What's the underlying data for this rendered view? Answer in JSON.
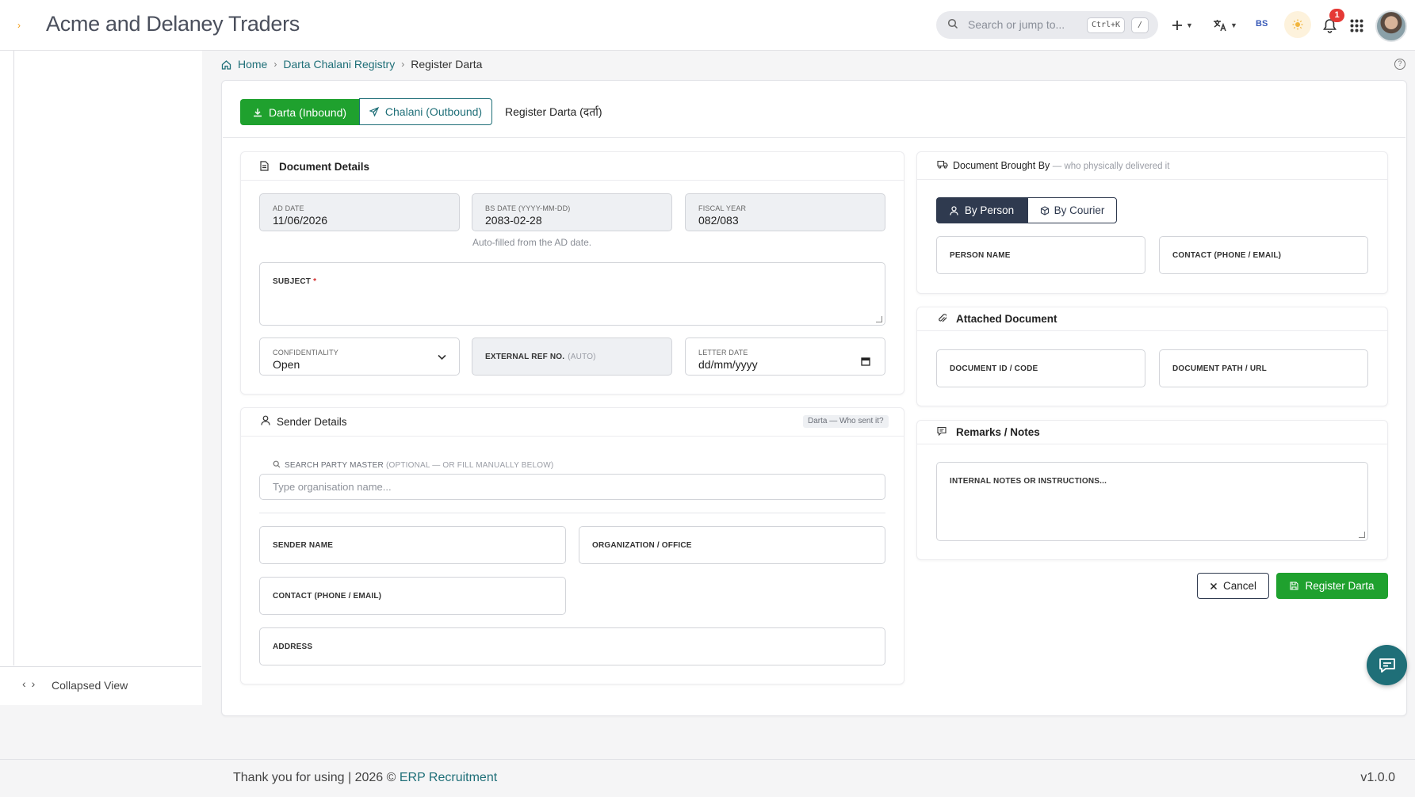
{
  "app": {
    "brand": "Acme and Delaney Traders"
  },
  "topbar": {
    "search_placeholder": "Search or jump to...",
    "shortcut": "Ctrl+K",
    "slash": "/",
    "calendar_label": "BS",
    "notification_count": "1"
  },
  "sidebar": {
    "collapse_label": "Collapsed View"
  },
  "breadcrumb": {
    "home": "Home",
    "registry": "Darta Chalani Registry",
    "current": "Register Darta"
  },
  "tabs": {
    "inbound": "Darta (Inbound)",
    "outbound": "Chalani (Outbound)",
    "title": "Register Darta (दर्ता)"
  },
  "document_details": {
    "title": "Document Details",
    "ad_date_label": "AD DATE",
    "ad_date": "11/06/2026",
    "bs_date_label": "BS DATE (YYYY-MM-DD)",
    "bs_date": "2083-02-28",
    "bs_hint": "Auto-filled from the AD date.",
    "fiscal_year_label": "FISCAL YEAR",
    "fiscal_year": "082/083",
    "subject_label": "SUBJECT",
    "confidentiality_label": "CONFIDENTIALITY",
    "confidentiality": "Open",
    "ext_ref_label": "EXTERNAL REF NO.",
    "ext_ref_muted": "(AUTO)",
    "letter_date_label": "LETTER DATE",
    "letter_date": "dd/mm/yyyy"
  },
  "sender_details": {
    "title": "Sender Details",
    "chip": "Darta — Who sent it?",
    "search_label": "SEARCH PARTY MASTER",
    "search_label_muted": "(OPTIONAL — OR FILL MANUALLY BELOW)",
    "search_placeholder": "Type organisation name...",
    "sender_name": "SENDER NAME",
    "organization": "ORGANIZATION / OFFICE",
    "contact": "CONTACT (PHONE / EMAIL)",
    "address": "ADDRESS"
  },
  "brought_by": {
    "title": "Document Brought By",
    "subtitle": "— who physically delivered it",
    "by_person": "By Person",
    "by_courier": "By Courier",
    "person_name": "PERSON NAME",
    "contact": "CONTACT (PHONE / EMAIL)"
  },
  "attached": {
    "title": "Attached Document",
    "doc_id": "DOCUMENT ID / CODE",
    "doc_path": "DOCUMENT PATH / URL"
  },
  "remarks": {
    "title": "Remarks / Notes",
    "placeholder": "INTERNAL NOTES OR INSTRUCTIONS..."
  },
  "actions": {
    "cancel": "Cancel",
    "register": "Register Darta"
  },
  "footer": {
    "text": "Thank you for using | 2026 ©",
    "link": "ERP Recruitment",
    "version": "v1.0.0"
  },
  "colors": {
    "accent_green": "#1fa12e",
    "accent_teal": "#1f6f78",
    "dark_navy": "#2f3a4f"
  }
}
